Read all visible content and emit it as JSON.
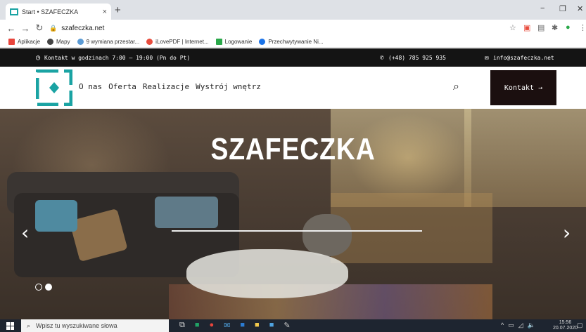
{
  "browser": {
    "tab_title": "Start • SZAFECZKA",
    "tab_close": "×",
    "new_tab": "+",
    "url": "szafeczka.net",
    "window_controls": [
      "−",
      "❐",
      "✕"
    ],
    "bookmarks": [
      {
        "label": "Aplikacje",
        "color": "#e8453c"
      },
      {
        "label": "Mapy",
        "color": "#444"
      },
      {
        "label": "9 wymiana przestar...",
        "color": "#5b9bd5"
      },
      {
        "label": "iLovePDF | Internet...",
        "color": "#e84c3d"
      },
      {
        "label": "Logowanie",
        "color": "#2aa84a"
      },
      {
        "label": "Przechwytywanie Ni...",
        "color": "#1a73e8"
      }
    ]
  },
  "site": {
    "topbar": {
      "hours": "Kontakt w godzinach 7:00 – 19:00 (Pn do Pt)",
      "phone": "(+48) 785 925 935",
      "email": "info@szafeczka.net"
    },
    "nav": [
      "O nas",
      "Oferta",
      "Realizacje",
      "Wystrój wnętrz"
    ],
    "contact_button": "Kontakt →",
    "accent_color": "#1aa3a3",
    "hero": {
      "title": "SZAFECZKA",
      "slides": 2,
      "active_slide": 2,
      "prev_arrow": "‹",
      "next_arrow": "›"
    }
  },
  "taskbar": {
    "search_placeholder": "Wpisz tu wyszukiwane słowa",
    "time": "15:56",
    "date": "20.07.2020"
  }
}
